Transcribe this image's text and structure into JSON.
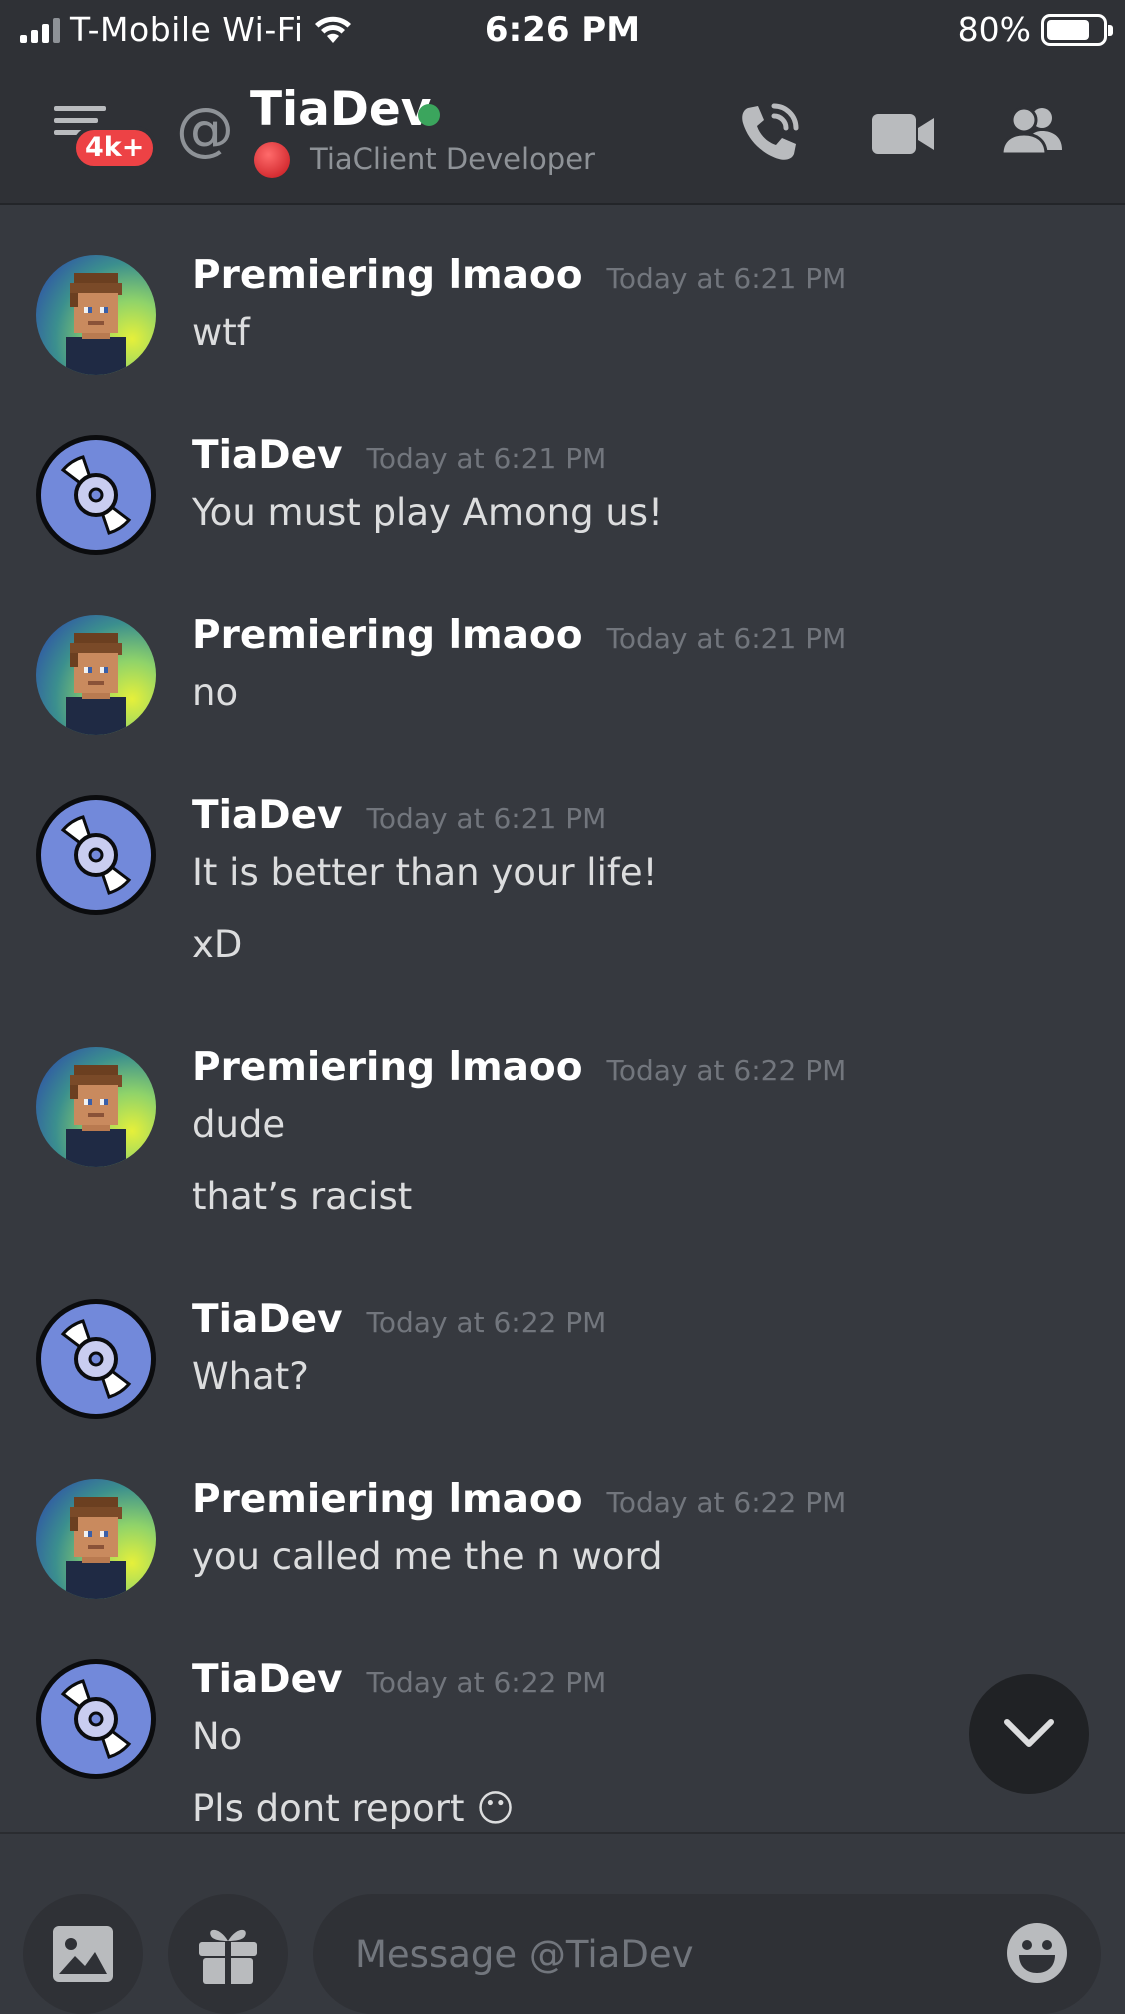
{
  "status_bar": {
    "carrier": "T-Mobile Wi-Fi",
    "time": "6:26 PM",
    "battery": "80%",
    "battery_level": 0.8
  },
  "header": {
    "unread_badge": "4k+",
    "at_symbol": "@",
    "name": "TiaDev",
    "presence": "online",
    "custom_status": "TiaClient Developer",
    "colors": {
      "online": "#3ba55d",
      "badge": "#ed4245"
    }
  },
  "messages": [
    {
      "author": "Premiering lmaoo",
      "timestamp": "Today at 6:21 PM",
      "avatar": "pixel-avatar",
      "lines": [
        "wtf"
      ]
    },
    {
      "author": "TiaDev",
      "timestamp": "Today at 6:21 PM",
      "avatar": "disc-avatar",
      "lines": [
        "You must play Among us!"
      ]
    },
    {
      "author": "Premiering lmaoo",
      "timestamp": "Today at 6:21 PM",
      "avatar": "pixel-avatar",
      "lines": [
        "no"
      ]
    },
    {
      "author": "TiaDev",
      "timestamp": "Today at 6:21 PM",
      "avatar": "disc-avatar",
      "lines": [
        "It is better than your life!",
        "xD"
      ]
    },
    {
      "author": "Premiering lmaoo",
      "timestamp": "Today at 6:22 PM",
      "avatar": "pixel-avatar",
      "lines": [
        "dude",
        "that’s racist"
      ]
    },
    {
      "author": "TiaDev",
      "timestamp": "Today at 6:22 PM",
      "avatar": "disc-avatar",
      "lines": [
        "What?"
      ]
    },
    {
      "author": "Premiering lmaoo",
      "timestamp": "Today at 6:22 PM",
      "avatar": "pixel-avatar",
      "lines": [
        "you called me the n word"
      ]
    },
    {
      "author": "TiaDev",
      "timestamp": "Today at 6:22 PM",
      "avatar": "disc-avatar",
      "lines": [
        "No",
        "Pls dont report 😶"
      ]
    }
  ],
  "composer": {
    "placeholder": "Message @TiaDev",
    "value": ""
  }
}
